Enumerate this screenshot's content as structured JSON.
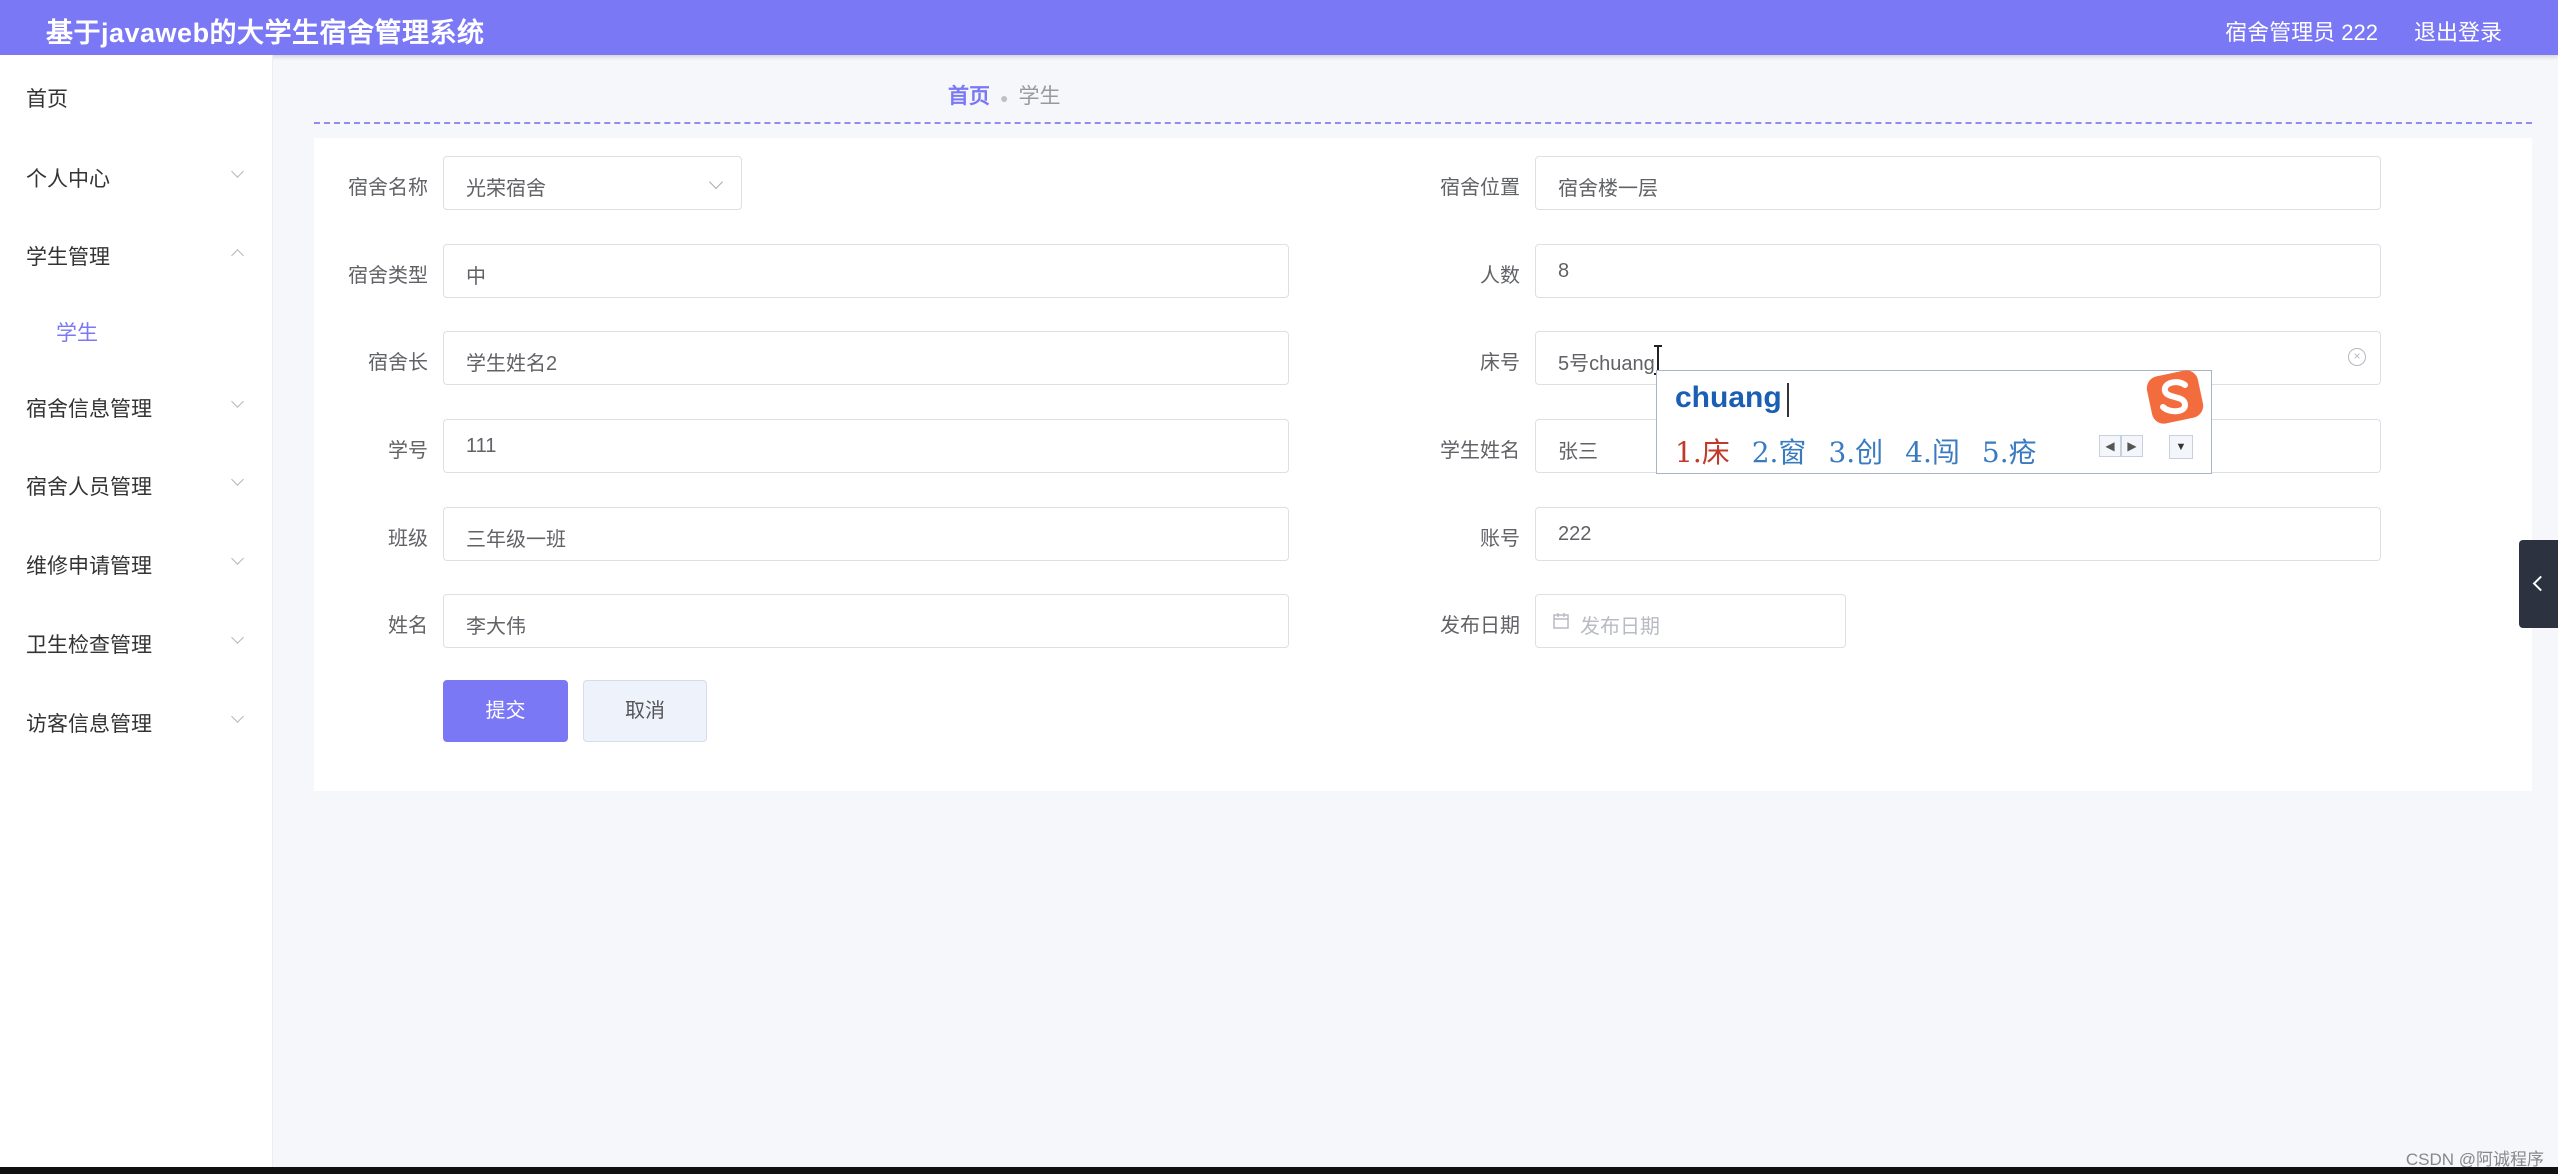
{
  "header": {
    "title": "基于javaweb的大学生宿舍管理系统",
    "user": "宿舍管理员 222",
    "logout": "退出登录"
  },
  "sidebar": {
    "items": [
      {
        "label": "首页"
      },
      {
        "label": "个人中心"
      },
      {
        "label": "学生管理"
      },
      {
        "label": "学生"
      },
      {
        "label": "宿舍信息管理"
      },
      {
        "label": "宿舍人员管理"
      },
      {
        "label": "维修申请管理"
      },
      {
        "label": "卫生检查管理"
      },
      {
        "label": "访客信息管理"
      }
    ]
  },
  "breadcrumb": {
    "home": "首页",
    "current": "学生"
  },
  "form": {
    "dorm_name": {
      "label": "宿舍名称",
      "value": "光荣宿舍"
    },
    "dorm_location": {
      "label": "宿舍位置",
      "value": "宿舍楼一层"
    },
    "dorm_type": {
      "label": "宿舍类型",
      "value": "中"
    },
    "count": {
      "label": "人数",
      "value": "8"
    },
    "dorm_head": {
      "label": "宿舍长",
      "value": "学生姓名2"
    },
    "bed_no": {
      "label": "床号",
      "value": "5号chuang"
    },
    "student_no": {
      "label": "学号",
      "value": "111"
    },
    "student_name": {
      "label": "学生姓名",
      "value": "张三"
    },
    "class": {
      "label": "班级",
      "value": "三年级一班"
    },
    "account": {
      "label": "账号",
      "value": "222"
    },
    "name": {
      "label": "姓名",
      "value": "李大伟"
    },
    "publish_date": {
      "label": "发布日期",
      "placeholder": "发布日期"
    },
    "submit": "提交",
    "cancel": "取消"
  },
  "ime": {
    "pinyin": "chuang",
    "candidates": [
      "1.床",
      "2.窗",
      "3.创",
      "4.闯",
      "5.疮"
    ]
  },
  "watermark": "CSDN @阿诚程序",
  "colors": {
    "accent": "#7b78f6",
    "sidetab": "#2c3240"
  }
}
